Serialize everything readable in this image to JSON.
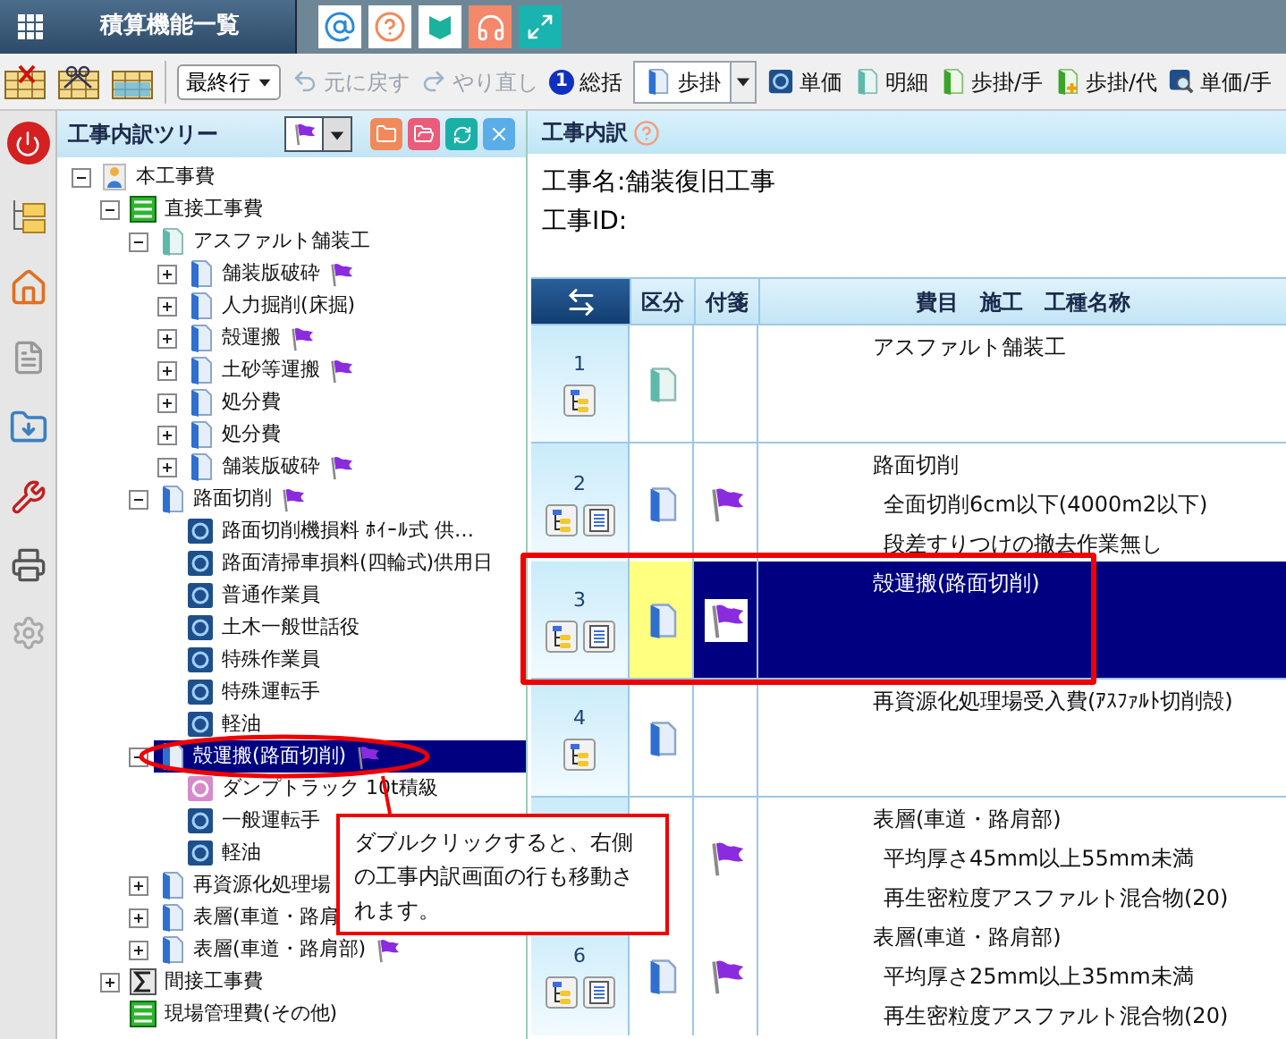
{
  "menu_button": {
    "label": "積算機能一覧"
  },
  "toolbar": {
    "position_select": {
      "value": "最終行"
    },
    "items": [
      {
        "kind": "undo",
        "label": "元に戻す",
        "disabled": true
      },
      {
        "kind": "redo",
        "label": "やり直し",
        "disabled": true
      },
      {
        "kind": "summary",
        "badge": "1",
        "label": "総括",
        "disabled": false
      },
      {
        "kind": "split",
        "label": "歩掛",
        "disabled": false
      },
      {
        "kind": "unit",
        "label": "単価",
        "disabled": false
      },
      {
        "kind": "detail",
        "label": "明細",
        "disabled": false
      },
      {
        "kind": "step-hand",
        "label": "歩掛/手",
        "disabled": false
      },
      {
        "kind": "step-sub",
        "label": "歩掛/代",
        "disabled": false
      },
      {
        "kind": "unit-hand",
        "label": "単価/手",
        "disabled": false
      }
    ]
  },
  "tree": {
    "title": "工事内訳ツリー",
    "nodes": [
      {
        "label": "本工事費",
        "kind": "person",
        "expanded": true,
        "selected": false,
        "flag": false,
        "children": [
          {
            "label": "直接工事費",
            "kind": "list",
            "expanded": true,
            "selected": false,
            "flag": false,
            "children": [
              {
                "label": "アスファルト舗装工",
                "kind": "folder-teal",
                "expanded": true,
                "selected": false,
                "flag": false,
                "children": [
                  {
                    "label": "舗装版破砕",
                    "kind": "folder",
                    "expanded": false,
                    "selected": false,
                    "flag": true
                  },
                  {
                    "label": "人力掘削(床掘)",
                    "kind": "folder",
                    "expanded": false,
                    "selected": false,
                    "flag": false
                  },
                  {
                    "label": "殻運搬",
                    "kind": "folder",
                    "expanded": false,
                    "selected": false,
                    "flag": true
                  },
                  {
                    "label": "土砂等運搬",
                    "kind": "folder",
                    "expanded": false,
                    "selected": false,
                    "flag": true
                  },
                  {
                    "label": "処分費",
                    "kind": "folder",
                    "expanded": false,
                    "selected": false,
                    "flag": false
                  },
                  {
                    "label": "処分費",
                    "kind": "folder",
                    "expanded": false,
                    "selected": false,
                    "flag": false
                  },
                  {
                    "label": "舗装版破砕",
                    "kind": "folder",
                    "expanded": false,
                    "selected": false,
                    "flag": true
                  }
                ]
              },
              {
                "label": "路面切削",
                "kind": "folder",
                "expanded": true,
                "selected": false,
                "flag": true,
                "children": [
                  {
                    "label": "路面切削機損料 ﾎｲｰﾙ式 供…",
                    "kind": "item",
                    "selected": false,
                    "flag": false
                  },
                  {
                    "label": "路面清掃車損料(四輪式)供用日",
                    "kind": "item",
                    "selected": false,
                    "flag": false
                  },
                  {
                    "label": "普通作業員",
                    "kind": "item",
                    "selected": false,
                    "flag": false
                  },
                  {
                    "label": "土木一般世話役",
                    "kind": "item",
                    "selected": false,
                    "flag": false
                  },
                  {
                    "label": "特殊作業員",
                    "kind": "item",
                    "selected": false,
                    "flag": false
                  },
                  {
                    "label": "特殊運転手",
                    "kind": "item",
                    "selected": false,
                    "flag": false
                  },
                  {
                    "label": "軽油",
                    "kind": "item",
                    "selected": false,
                    "flag": false
                  }
                ]
              },
              {
                "label": "殻運搬(路面切削)",
                "kind": "folder",
                "expanded": true,
                "selected": true,
                "flag": true,
                "children": [
                  {
                    "label": "ダンプトラック 10t積級",
                    "kind": "item-pink",
                    "selected": false,
                    "flag": false
                  },
                  {
                    "label": "一般運転手",
                    "kind": "item",
                    "selected": false,
                    "flag": false
                  },
                  {
                    "label": "軽油",
                    "kind": "item",
                    "selected": false,
                    "flag": false
                  }
                ]
              },
              {
                "label": "再資源化処理場",
                "kind": "folder",
                "expanded": false,
                "selected": false,
                "flag": false
              },
              {
                "label": "表層(車道・路肩",
                "kind": "folder",
                "expanded": false,
                "selected": false,
                "flag": false
              },
              {
                "label": "表層(車道・路肩部)",
                "kind": "folder",
                "expanded": false,
                "selected": false,
                "flag": true
              }
            ]
          },
          {
            "label": "間接工事費",
            "kind": "sum",
            "expanded": false,
            "selected": false,
            "flag": false
          },
          {
            "label": "現場管理費(その他)",
            "kind": "list",
            "selected": false,
            "flag": false
          }
        ]
      }
    ]
  },
  "detail": {
    "title": "工事内訳",
    "project_name": "工事名:舗装復旧工事",
    "project_id": "工事ID:",
    "columns": [
      "区分",
      "付箋",
      "費目　施工　工種名称"
    ],
    "rows": [
      {
        "number": "1",
        "tree_button": true,
        "list_button": false,
        "kind": "folder-teal",
        "flag": false,
        "selected": false,
        "lines": [
          "アスファルト舗装工"
        ]
      },
      {
        "number": "2",
        "tree_button": true,
        "list_button": true,
        "kind": "folder",
        "flag": true,
        "selected": false,
        "lines": [
          "路面切削",
          "全面切削6cm以下(4000m2以下)",
          "段差すりつけの撤去作業無し"
        ]
      },
      {
        "number": "3",
        "tree_button": true,
        "list_button": true,
        "kind": "folder",
        "flag": true,
        "selected": true,
        "lines": [
          "殻運搬(路面切削)"
        ]
      },
      {
        "number": "4",
        "tree_button": true,
        "list_button": false,
        "kind": "folder",
        "flag": false,
        "selected": false,
        "lines": [
          "再資源化処理場受入費(ｱｽﾌｧﾙﾄ切削殻)"
        ]
      },
      {
        "tree_button": false,
        "list_button": false,
        "flag": true,
        "selected": false,
        "lines": [
          "表層(車道・路肩部)",
          "平均厚さ45mm以上55mm未満",
          "再生密粒度アスファルト混合物(20)"
        ]
      },
      {
        "number": "6",
        "tree_button": true,
        "list_button": true,
        "kind": "folder",
        "flag": true,
        "selected": false,
        "lines": [
          "表層(車道・路肩部)",
          "平均厚さ25mm以上35mm未満",
          "再生密粒度アスファルト混合物(20)"
        ]
      }
    ]
  },
  "callout": {
    "text": "ダブルクリックすると、右側の工事内訳画面の行も移動されます。"
  }
}
